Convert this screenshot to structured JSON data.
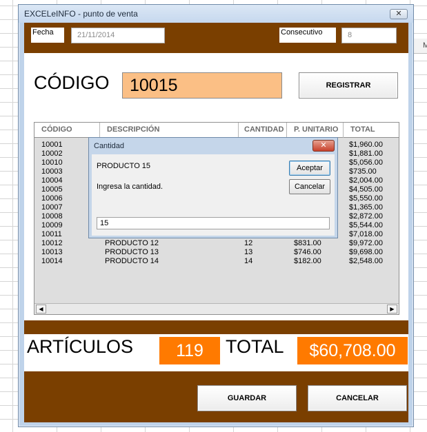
{
  "window": {
    "title": "EXCELeINFO - punto de venta",
    "close_glyph": "✕"
  },
  "excel": {
    "col_header": "M"
  },
  "header": {
    "fecha_label": "Fecha",
    "fecha_value": "21/11/2014",
    "consecutivo_label": "Consecutivo",
    "consecutivo_value": "8"
  },
  "codigo": {
    "label": "CÓDIGO",
    "value": "10015",
    "register_button": "REGISTRAR"
  },
  "table": {
    "columns": [
      "CÓDIGO",
      "DESCRIPCIÓN",
      "CANTIDAD",
      "P. UNITARIO",
      "TOTAL"
    ],
    "rows": [
      {
        "codigo": "10001",
        "descripcion": "",
        "cantidad": "",
        "unitario": "",
        "total": "$1,960.00"
      },
      {
        "codigo": "10002",
        "descripcion": "",
        "cantidad": "",
        "unitario": "",
        "total": "$1,881.00"
      },
      {
        "codigo": "10010",
        "descripcion": "",
        "cantidad": "",
        "unitario": "",
        "total": "$5,056.00"
      },
      {
        "codigo": "10003",
        "descripcion": "",
        "cantidad": "",
        "unitario": "",
        "total": "$735.00"
      },
      {
        "codigo": "10004",
        "descripcion": "",
        "cantidad": "",
        "unitario": "",
        "total": "$2,004.00"
      },
      {
        "codigo": "10005",
        "descripcion": "",
        "cantidad": "",
        "unitario": "",
        "total": "$4,505.00"
      },
      {
        "codigo": "10006",
        "descripcion": "",
        "cantidad": "",
        "unitario": "",
        "total": "$5,550.00"
      },
      {
        "codigo": "10007",
        "descripcion": "",
        "cantidad": "",
        "unitario": "",
        "total": "$1,365.00"
      },
      {
        "codigo": "10008",
        "descripcion": "",
        "cantidad": "",
        "unitario": "",
        "total": "$2,872.00"
      },
      {
        "codigo": "10009",
        "descripcion": "",
        "cantidad": "",
        "unitario": "",
        "total": "$5,544.00"
      },
      {
        "codigo": "10011",
        "descripcion": "",
        "cantidad": "",
        "unitario": "",
        "total": "$7,018.00"
      },
      {
        "codigo": "10012",
        "descripcion": "PRODUCTO 12",
        "cantidad": "12",
        "unitario": "$831.00",
        "total": "$9,972.00"
      },
      {
        "codigo": "10013",
        "descripcion": "PRODUCTO 13",
        "cantidad": "13",
        "unitario": "$746.00",
        "total": "$9,698.00"
      },
      {
        "codigo": "10014",
        "descripcion": "PRODUCTO 14",
        "cantidad": "14",
        "unitario": "$182.00",
        "total": "$2,548.00"
      }
    ]
  },
  "scrollbar": {
    "left_glyph": "◀",
    "right_glyph": "▶"
  },
  "summary": {
    "articulos_label": "ARTÍCULOS",
    "articulos_value": "119",
    "total_label": "TOTAL",
    "total_value": "$60,708.00"
  },
  "actions": {
    "guardar": "GUARDAR",
    "cancelar": "CANCELAR"
  },
  "dialog": {
    "title": "Cantidad",
    "close_glyph": "✕",
    "product": "PRODUCTO 15",
    "prompt": "Ingresa la cantidad.",
    "accept": "Aceptar",
    "cancel": "Cancelar",
    "input_value": "15"
  },
  "colors": {
    "brown": "#7a3f00",
    "orange": "#ff7a00",
    "codigo_bg": "#fbbf85"
  }
}
